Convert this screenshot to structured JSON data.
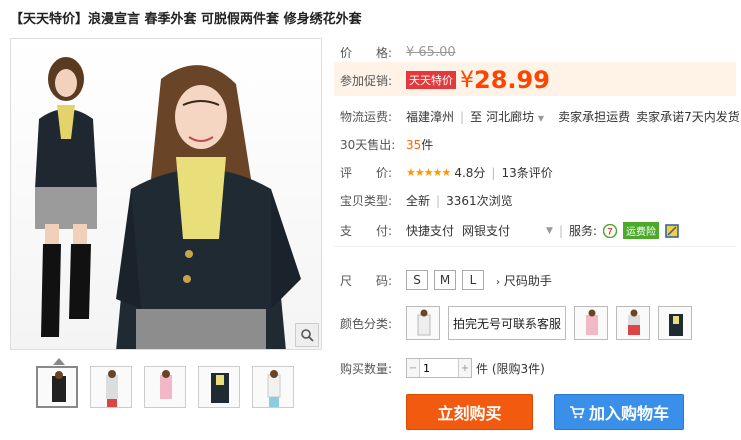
{
  "product": {
    "title": "【天天特价】浪漫宣言 春季外套 可脱假两件套 修身绣花外套"
  },
  "price": {
    "label": "价　　格:",
    "original": "¥ 65.00",
    "promo_label": "参加促销:",
    "promo_tag": "天天特价",
    "currency": "¥",
    "current": "28.99"
  },
  "shipping": {
    "label": "物流运费:",
    "from": "福建漳州",
    "to_prefix": "至",
    "to": "河北廊坊",
    "fee_note": "卖家承担运费",
    "delivery_note": "卖家承诺7天内发货"
  },
  "sales": {
    "label": "30天售出:",
    "count": "35",
    "unit": "件"
  },
  "rating": {
    "label": "评　　价:",
    "stars": "★★★★★",
    "score": "4.8分",
    "reviews": "13条评价"
  },
  "condition": {
    "label": "宝贝类型:",
    "value": "全新",
    "views": "3361次浏览"
  },
  "payment": {
    "label": "支　　付:",
    "method1": "快捷支付",
    "method2": "网银支付",
    "service_label": "服务:",
    "insurance": "运费险"
  },
  "size": {
    "label": "尺　　码:",
    "options": [
      "S",
      "M",
      "L"
    ],
    "help": "尺码助手"
  },
  "color": {
    "label": "颜色分类:",
    "text_option": "拍完无号可联系客服"
  },
  "quantity": {
    "label": "购买数量:",
    "value": "1",
    "unit_note": "件 (限购3件)"
  },
  "actions": {
    "buy_now": "立刻购买",
    "add_to_cart": "加入购物车"
  },
  "colors": {
    "price": "#ff4400",
    "promo_tag": "#e4393c",
    "buy_button": "#f25a0f",
    "cart_button": "#3a90e8"
  },
  "icons": {
    "zoom": "magnifier-icon",
    "dropdown": "chevron-down-icon",
    "cart": "cart-icon",
    "service_7day": "seven-day-return-icon",
    "service_extra": "guarantee-icon"
  }
}
